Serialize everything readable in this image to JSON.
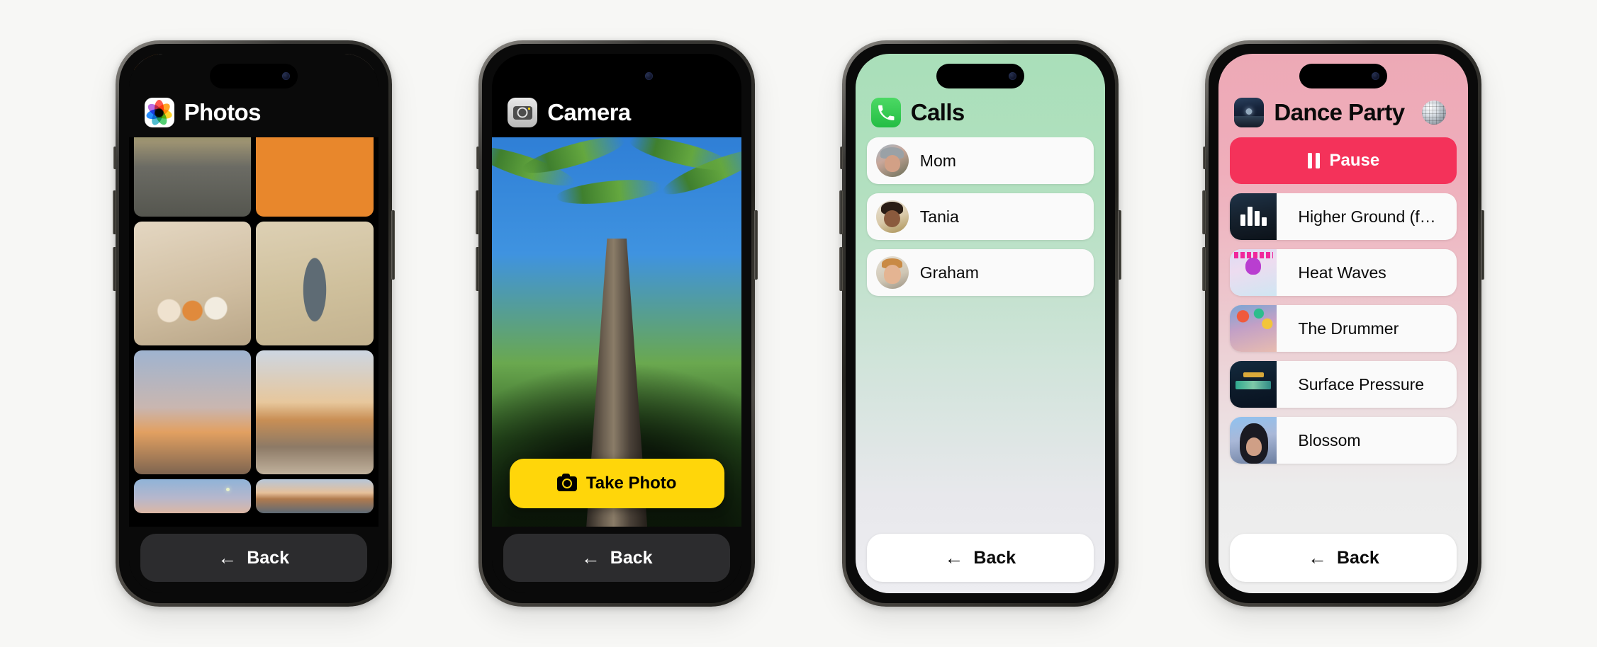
{
  "background_color": "#f7f7f5",
  "phones": [
    {
      "id": "photos",
      "app_name": "Photos",
      "app_icon": "photos-icon",
      "back_label": "Back",
      "back_arrow": "←",
      "photos": [
        {
          "name": "striped-beach-towel"
        },
        {
          "name": "sand-dune"
        },
        {
          "name": "wooden-stairs-to-beach"
        },
        {
          "name": "orange-beach-umbrella"
        },
        {
          "name": "seashells-in-sand"
        },
        {
          "name": "shadow-of-person-on-sand"
        },
        {
          "name": "sunrise-over-ocean"
        },
        {
          "name": "sunset-beach-waves"
        },
        {
          "name": "pastel-sky"
        },
        {
          "name": "dusk-shoreline"
        }
      ]
    },
    {
      "id": "camera",
      "app_name": "Camera",
      "app_icon": "camera-icon",
      "viewfinder": "palm-tree-looking-up",
      "shutter_label": "Take Photo",
      "shutter_icon": "camera-icon",
      "shutter_color": "#ffd60a",
      "back_label": "Back",
      "back_arrow": "←"
    },
    {
      "id": "calls",
      "app_name": "Calls",
      "app_icon": "phone-icon",
      "accent_color": "#34c759",
      "contacts": [
        {
          "name": "Mom",
          "avatar": "avatar-mom"
        },
        {
          "name": "Tania",
          "avatar": "avatar-tania"
        },
        {
          "name": "Graham",
          "avatar": "avatar-graham"
        }
      ],
      "back_label": "Back",
      "back_arrow": "←"
    },
    {
      "id": "music",
      "app_name": "Dance Party",
      "app_icon": "album-art-icon",
      "trailing_icon": "disco-ball-icon",
      "transport_label": "Pause",
      "transport_icon": "pause-icon",
      "transport_color": "#f4325a",
      "songs": [
        {
          "title": "Higher Ground (f…",
          "art": "album-art-higher-ground",
          "playing": true
        },
        {
          "title": "Heat Waves",
          "art": "album-art-heat-waves",
          "playing": false
        },
        {
          "title": "The Drummer",
          "art": "album-art-the-drummer",
          "playing": false
        },
        {
          "title": "Surface Pressure",
          "art": "album-art-encanto",
          "playing": false
        },
        {
          "title": "Blossom",
          "art": "album-art-blossom",
          "playing": false
        }
      ],
      "back_label": "Back",
      "back_arrow": "←"
    }
  ]
}
